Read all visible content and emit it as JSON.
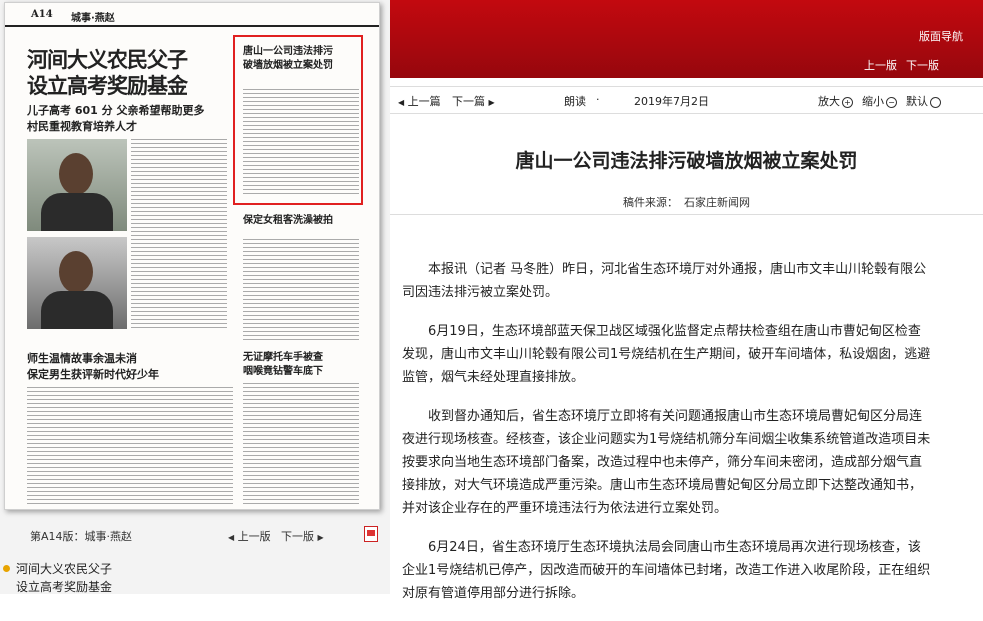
{
  "paper": {
    "page_no": "A14",
    "section": "城事·燕赵",
    "headline_lines": [
      "河间大义农民父子",
      "设立高考奖励基金"
    ],
    "subheadline_lines": [
      "儿子高考 601 分 父亲希望帮助更多",
      "村民重视教育培养人才"
    ],
    "side_title_lines": [
      "唐山一公司违法排污",
      "破墙放烟被立案处罚"
    ],
    "side_title2": "保定女租客洗澡被拍",
    "headline2_lines": [
      "师生温情故事余温未消",
      "保定男生获评新时代好少年"
    ],
    "side_title3_lines": [
      "无证摩托车手被查",
      "咽喉竟钻警车底下"
    ]
  },
  "left_nav": {
    "page_label": "第A14版：城事·燕赵",
    "prev": "上一版",
    "next": "下一版"
  },
  "article_list": [
    "河间大义农民父子",
    "设立高考奖励基金"
  ],
  "topbar": {
    "nav_link": "版面导航",
    "prev": "上一版",
    "next": "下一版"
  },
  "toolbar": {
    "prev_article": "上一篇",
    "next_article": "下一篇",
    "read": "朗读",
    "date": "2019年7月2日",
    "zoom_in": "放大",
    "zoom_out": "缩小",
    "default": "默认"
  },
  "article": {
    "title": "唐山一公司违法排污破墙放烟被立案处罚",
    "source_label": "稿件来源：",
    "source_value": "石家庄新闻网",
    "paragraphs": [
      "本报讯（记者 马冬胜）昨日，河北省生态环境厅对外通报，唐山市文丰山川轮毂有限公司因违法排污被立案处罚。",
      "6月19日，生态环境部蓝天保卫战区域强化监督定点帮扶检查组在唐山市曹妃甸区检查发现，唐山市文丰山川轮毂有限公司1号烧结机在生产期间，破开车间墙体，私设烟囱，逃避监管，烟气未经处理直接排放。",
      "收到督办通知后，省生态环境厅立即将有关问题通报唐山市生态环境局曹妃甸区分局连夜进行现场核查。经核查，该企业问题实为1号烧结机筛分车间烟尘收集系统管道改造项目未按要求向当地生态环境部门备案，改造过程中也未停产，筛分车间未密闭，造成部分烟气直接排放，对大气环境造成严重污染。唐山市生态环境局曹妃甸区分局立即下达整改通知书，并对该企业存在的严重环境违法行为依法进行立案处罚。",
      "6月24日，省生态环境厅生态环境执法局会同唐山市生态环境局再次进行现场核查，该企业1号烧结机已停产，因改造而破开的车间墙体已封堵，改造工作进入收尾阶段，正在组织对原有管道停用部分进行拆除。"
    ]
  },
  "colors": {
    "topbar": "#b0080e",
    "highlight_border": "#e02020",
    "bullet": "#e8a400"
  }
}
